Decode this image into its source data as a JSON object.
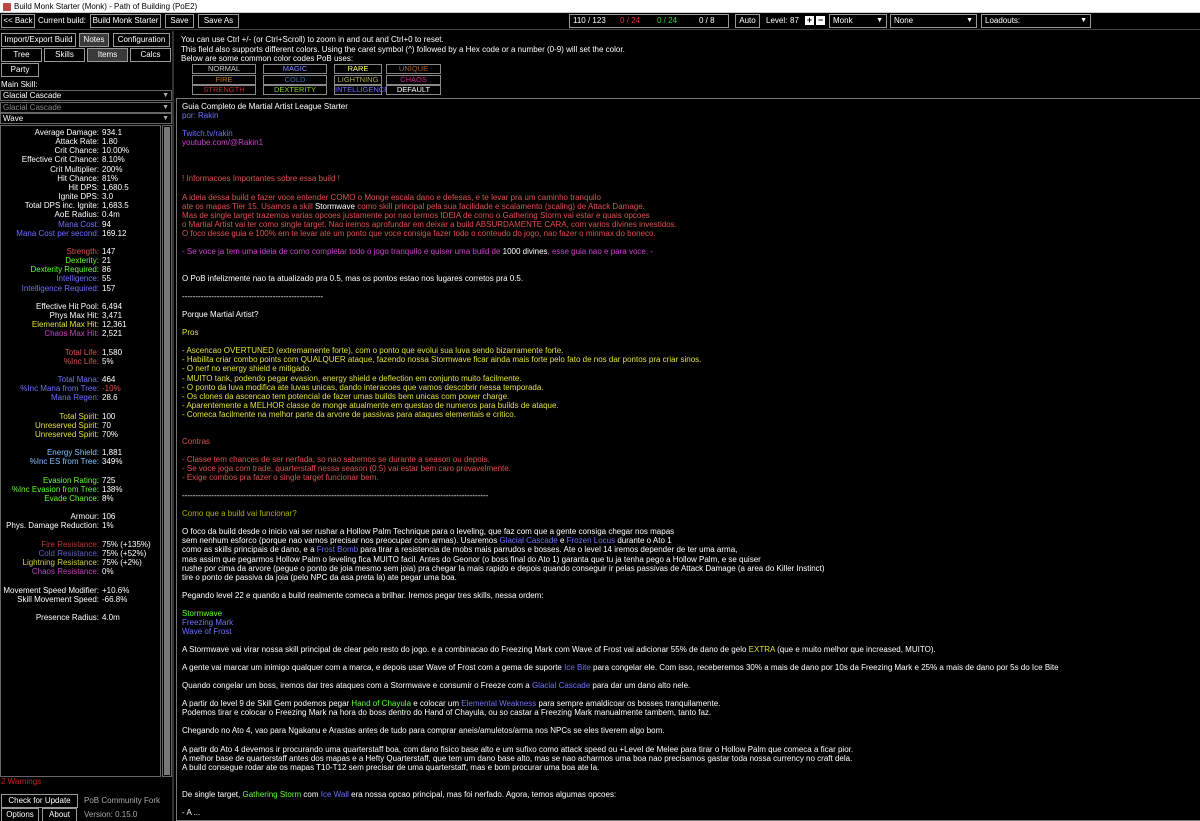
{
  "window": {
    "title": "Build Monk Starter (Monk) - Path of Building (PoE2)"
  },
  "topbar": {
    "back_label": "<< Back",
    "current_build_label": "Current build:",
    "build_name": "Build Monk Starter",
    "save_label": "Save",
    "save_as_label": "Save As",
    "points_main": "110 / 123",
    "points_red": "0 / 24",
    "points_green": "0 / 24",
    "points_white": "0 / 8",
    "auto_label": "Auto",
    "level_label": "Level:",
    "level_value": "87",
    "plus": "+",
    "minus": "−",
    "class_value": "Monk",
    "ascend_value": "None",
    "loadouts_value": "Loadouts:"
  },
  "left": {
    "tabs": [
      "Import/Export Build",
      "Notes",
      "Configuration",
      "Tree",
      "Skills",
      "Items",
      "Calcs",
      "Party"
    ],
    "main_skill_label": "Main Skill:",
    "skill_select": "Glacial Cascade",
    "skill_select_2": "Glacial Cascade",
    "skill_part": "Wave",
    "stats": [
      {
        "label": "Average Damage:",
        "value": "934.1",
        "color": "#ffffff"
      },
      {
        "label": "Attack Rate:",
        "value": "1.80",
        "color": "#ffffff"
      },
      {
        "label": "Crit Chance:",
        "value": "10.00%",
        "color": "#ffffff"
      },
      {
        "label": "Effective Crit Chance:",
        "value": "8.10%",
        "color": "#ffffff"
      },
      {
        "label": "Crit Multiplier:",
        "value": "200%",
        "color": "#ffffff"
      },
      {
        "label": "Hit Chance:",
        "value": "81%",
        "color": "#ffffff"
      },
      {
        "label": "Hit DPS:",
        "value": "1,680.5",
        "color": "#ffffff"
      },
      {
        "label": "Ignite DPS:",
        "value": "3.0",
        "color": "#ffffff"
      },
      {
        "label": "Total DPS inc. Ignite:",
        "value": "1,683.5",
        "color": "#ffffff"
      },
      {
        "label": "AoE Radius:",
        "value": "0.4m",
        "color": "#ffffff"
      },
      {
        "label": "Mana Cost:",
        "value": "94",
        "color": "#7070ff"
      },
      {
        "label": "Mana Cost per second:",
        "value": "169.12",
        "color": "#7070ff"
      },
      {
        "label": "",
        "value": "",
        "color": "#ffffff"
      },
      {
        "label": "Strength:",
        "value": "147",
        "color": "#e05050"
      },
      {
        "label": "Dexterity:",
        "value": "21",
        "color": "#60ff30"
      },
      {
        "label": "Dexterity Required:",
        "value": "86",
        "color": "#60ff30"
      },
      {
        "label": "Intelligence:",
        "value": "55",
        "color": "#7070ff"
      },
      {
        "label": "Intelligence Required:",
        "value": "157",
        "color": "#7070ff"
      },
      {
        "label": "",
        "value": "",
        "color": "#ffffff"
      },
      {
        "label": "Effective Hit Pool:",
        "value": "6,494",
        "color": "#ffffff"
      },
      {
        "label": "Phys Max Hit:",
        "value": "3,471",
        "color": "#ffffff"
      },
      {
        "label": "Elemental Max Hit:",
        "value": "12,361",
        "color": "#e0e040"
      },
      {
        "label": "Chaos Max Hit:",
        "value": "2,521",
        "color": "#d040d0"
      },
      {
        "label": "",
        "value": "",
        "color": "#ffffff"
      },
      {
        "label": "Total Life:",
        "value": "1,580",
        "color": "#e05050"
      },
      {
        "label": "%Inc Life:",
        "value": "5%",
        "color": "#e05050"
      },
      {
        "label": "",
        "value": "",
        "color": "#ffffff"
      },
      {
        "label": "Total Mana:",
        "value": "464",
        "color": "#7070ff"
      },
      {
        "label": "%Inc Mana from Tree:",
        "value": "-10%",
        "color": "#7070ff",
        "valcolor": "#e05050"
      },
      {
        "label": "Mana Regen:",
        "value": "28.6",
        "color": "#7070ff"
      },
      {
        "label": "",
        "value": "",
        "color": "#ffffff"
      },
      {
        "label": "Total Spirit:",
        "value": "100",
        "color": "#e0e040"
      },
      {
        "label": "Unreserved Spirit:",
        "value": "70",
        "color": "#e0e040"
      },
      {
        "label": "Unreserved Spirit:",
        "value": "70%",
        "color": "#e0e040"
      },
      {
        "label": "",
        "value": "",
        "color": "#ffffff"
      },
      {
        "label": "Energy Shield:",
        "value": "1,881",
        "color": "#80c0ff"
      },
      {
        "label": "%Inc ES from Tree:",
        "value": "349%",
        "color": "#80c0ff"
      },
      {
        "label": "",
        "value": "",
        "color": "#ffffff"
      },
      {
        "label": "Evasion Rating:",
        "value": "725",
        "color": "#60ff30"
      },
      {
        "label": "%Inc Evasion from Tree:",
        "value": "138%",
        "color": "#60ff30"
      },
      {
        "label": "Evade Chance:",
        "value": "8%",
        "color": "#60ff30"
      },
      {
        "label": "",
        "value": "",
        "color": "#ffffff"
      },
      {
        "label": "Armour:",
        "value": "106",
        "color": "#ffffff"
      },
      {
        "label": "Phys. Damage Reduction:",
        "value": "1%",
        "color": "#ffffff"
      },
      {
        "label": "",
        "value": "",
        "color": "#ffffff"
      },
      {
        "label": "Fire Resistance:",
        "value": "75% (+135%)",
        "color": "#c03030"
      },
      {
        "label": "Cold Resistance:",
        "value": "75% (+52%)",
        "color": "#6060d0"
      },
      {
        "label": "Lightning Resistance:",
        "value": "75% (+2%)",
        "color": "#d0d040"
      },
      {
        "label": "Chaos Resistance:",
        "value": "0%",
        "color": "#c040c0"
      },
      {
        "label": "",
        "value": "",
        "color": "#ffffff"
      },
      {
        "label": "Movement Speed Modifier:",
        "value": "+10.6%",
        "color": "#ffffff"
      },
      {
        "label": "Skill Movement Speed:",
        "value": "-66.8%",
        "color": "#ffffff"
      },
      {
        "label": "",
        "value": "",
        "color": "#ffffff"
      },
      {
        "label": "Presence Radius:",
        "value": "4.0m",
        "color": "#ffffff"
      }
    ],
    "warnings": "2 Warnings",
    "check_update": "Check for Update",
    "community_fork": "PoB Community Fork",
    "options": "Options",
    "about": "About",
    "version": "Version: 0.15.0"
  },
  "right": {
    "info1": "You can use Ctrl +/- (or Ctrl+Scroll) to zoom in and out and Ctrl+0 to reset.",
    "info2": "This field also supports different colors.  Using the caret symbol (^) followed by a Hex code or a number (0-9) will set the color.",
    "info3": "Below are some common color codes PoB uses:",
    "color_codes": [
      {
        "label": "NORMAL",
        "color": "#c8c8c8"
      },
      {
        "label": "MAGIC",
        "color": "#8888ff"
      },
      {
        "label": "RARE",
        "color": "#ffff77"
      },
      {
        "label": "UNIQUE",
        "color": "#af6025"
      },
      {
        "label": "FIRE",
        "color": "#b97123"
      },
      {
        "label": "COLD",
        "color": "#3f6db3"
      },
      {
        "label": "LIGHTNING",
        "color": "#adaa47"
      },
      {
        "label": "CHAOS",
        "color": "#d02090"
      },
      {
        "label": "STRENGTH",
        "color": "#b9302b"
      },
      {
        "label": "DEXTERITY",
        "color": "#7fd22e"
      },
      {
        "label": "INTELLIGENCE",
        "color": "#6f6fff"
      },
      {
        "label": "DEFAULT",
        "color": "#ffffff"
      }
    ],
    "notes": [
      [
        [
          "w",
          "Guia Completo de Martial Artist League Starter"
        ]
      ],
      [
        [
          "b",
          "por: Rakin"
        ]
      ],
      [],
      [
        [
          "b",
          "Twitch.tv/rakin"
        ]
      ],
      [
        [
          "p",
          "youtube.com/@Rakin1"
        ]
      ],
      [],
      [],
      [],
      [
        [
          "m",
          "! Informacoes Importantes sobre essa build !"
        ]
      ],
      [],
      [
        [
          "m",
          "A ideia dessa build e fazer voce entender COMO o Monge escala dano e defesas, e te levar pra um caminho tranquilo"
        ]
      ],
      [
        [
          "m",
          "ate os mapas Tier 15. Usamos a skill "
        ],
        [
          "w",
          "Stormwave"
        ],
        [
          "m",
          " como skill principal pela sua facilidade e scalamento (scaling) de Attack Damage."
        ]
      ],
      [
        [
          "m",
          "Mas de single target trazemos varias opcoes justamente por nao termos IDEIA de como o Gathering Storm vai estar e quais opcoes"
        ]
      ],
      [
        [
          "m",
          "o Martial Artist vai ter como single target. Nao iremos aprofundar em deixar a build ABSURDAMENTE CARA, com varios divines investidos."
        ]
      ],
      [
        [
          "m",
          "O foco desse guia e 100% em te levar ate um ponto que voce consiga fazer todo o conteudo do jogo, nao fazer o minmax do boneco."
        ]
      ],
      [],
      [
        [
          "p",
          " - Se voce ja tem uma ideia de como completar todo o jogo tranquilo e quiser uma build de "
        ],
        [
          "w",
          "1000 divines"
        ],
        [
          "p",
          ", esse guia nao e para voce. -"
        ]
      ],
      [],
      [],
      [
        [
          "w",
          "O PoB infelizmente nao ta atualizado pra 0.5, mas os pontos estao nos lugares corretos pra 0.5."
        ]
      ],
      [],
      [
        [
          "w",
          "-----------------------------------------------------"
        ]
      ],
      [],
      [
        [
          "w",
          "Porque Martial Artist?"
        ]
      ],
      [],
      [
        [
          "y",
          "Pros"
        ]
      ],
      [],
      [
        [
          "y",
          "- Ascencao OVERTUNED (extremamente forte), com o ponto que evolui sua luva sendo bizarramente forte."
        ]
      ],
      [
        [
          "y",
          "- Habilita criar combo points com QUALQUER ataque, fazendo nossa Stormwave ficar ainda mais forte pelo fato de nos dar pontos pra criar sinos."
        ]
      ],
      [
        [
          "y",
          "- O nerf no energy shield e mitigado."
        ]
      ],
      [
        [
          "y",
          "- MUITO tank, podendo pegar evasion, energy shield e deflection em conjunto muito facilmente."
        ]
      ],
      [
        [
          "y",
          "- O ponto da luva modifica ate luvas unicas, dando interacoes que vamos descobrir nessa temporada."
        ]
      ],
      [
        [
          "y",
          "- Os clones da ascencao tem potencial de fazer umas builds bem unicas com power charge."
        ]
      ],
      [
        [
          "y",
          "- Aparentemente a MELHOR classe de monge atualmente em questao de numeros para builds de ataque."
        ]
      ],
      [
        [
          "y",
          "- Comeca facilmente na melhor parte da arvore de passivas para ataques elementais e critico."
        ]
      ],
      [],
      [],
      [
        [
          "m",
          "Contras"
        ]
      ],
      [],
      [
        [
          "m",
          "- Classe tem chances de ser nerfada, so nao sabemos se durante a season ou depois."
        ]
      ],
      [
        [
          "m",
          "- Se voce joga com trade, quarterstaff nessa season (0.5) vai estar bem caro provavelmente."
        ]
      ],
      [
        [
          "m",
          "- Exige combos pra fazer o single target funcionar bem."
        ]
      ],
      [],
      [
        [
          "w",
          "-------------------------------------------------------------------------------------------------------------------"
        ]
      ],
      [],
      [
        [
          "s",
          "Como que a build vai funcionar?"
        ]
      ],
      [],
      [
        [
          "w",
          "O foco da build desde o inicio vai ser rushar a Hollow Palm Technique para o leveling, que faz com que a gente consiga chegar nos mapas"
        ]
      ],
      [
        [
          "w",
          "sem nenhum esforco (porque nao vamos precisar nos preocupar com armas). Usaremos "
        ],
        [
          "b",
          "Glacial Cascade"
        ],
        [
          "w",
          " e "
        ],
        [
          "b",
          "Frozen Locus"
        ],
        [
          "w",
          " durante o Ato 1"
        ]
      ],
      [
        [
          "w",
          "como as skills principais de dano, e a "
        ],
        [
          "b",
          "Frost Bomb"
        ],
        [
          "w",
          " para tirar a resistencia de mobs mais parrudos e bosses. Ate o level 14 iremos depender de ter uma arma,"
        ]
      ],
      [
        [
          "w",
          "mas assim que pegarmos Hollow Palm o leveling fica MUITO facil. Antes do Geonor (o boss final do Ato 1) garanta que tu ja tenha pego a Hollow Palm, e se quiser"
        ]
      ],
      [
        [
          "w",
          "rushe por cima da arvore (pegue o ponto de joia mesmo sem joia) pra chegar la mais rapido e depois quando conseguir ir pelas passivas de Attack Damage (a area do Killer Instinct)"
        ]
      ],
      [
        [
          "w",
          "tire o ponto de passiva da joia (pelo NPC da asa preta la) ate pegar uma boa."
        ]
      ],
      [],
      [
        [
          "w",
          "Pegando level 22 e quando a build realmente comeca a brilhar.  Iremos pegar tres skills, nessa ordem:"
        ]
      ],
      [],
      [
        [
          "g",
          "Stormwave"
        ]
      ],
      [
        [
          "b",
          "Freezing Mark"
        ]
      ],
      [
        [
          "b",
          "Wave of Frost"
        ]
      ],
      [],
      [
        [
          "w",
          "A Stormwave vai virar nossa skill principal de clear pelo resto do jogo. e a combinacao do Freezing Mark com Wave of Frost vai adicionar 55% de dano de gelo "
        ],
        [
          "y",
          "EXTRA"
        ],
        [
          "w",
          " (que e muito melhor que increased, MUITO)."
        ]
      ],
      [],
      [
        [
          "w",
          "A gente vai marcar um inimigo qualquer com a marca, e depois usar Wave of Frost com a gema de suporte "
        ],
        [
          "b",
          "Ice Bite"
        ],
        [
          "w",
          " para congelar ele. Com isso, receberemos 30% a mais de dano por 10s da Freezing Mark e 25% a mais de dano por 5s do Ice Bite"
        ]
      ],
      [],
      [
        [
          "w",
          "Quando congelar um boss, iremos dar tres ataques com a Stormwave e consumir o Freeze com a "
        ],
        [
          "b",
          "Glacial Cascade"
        ],
        [
          "w",
          " para dar um dano alto nele."
        ]
      ],
      [],
      [
        [
          "w",
          "A partir do level 9 de Skill Gem podemos pegar "
        ],
        [
          "g",
          "Hand of Chayula"
        ],
        [
          "w",
          " e colocar um "
        ],
        [
          "b",
          "Elemental Weakness"
        ],
        [
          "w",
          " para sempre amaldicoar os bosses tranquilamente."
        ]
      ],
      [
        [
          "w",
          " Podemos tirar e colocar o Freezing Mark na hora do boss dentro do Hand of Chayula, ou so castar a Freezing Mark manualmente tambem, tanto faz."
        ]
      ],
      [],
      [
        [
          "w",
          "Chegando no Ato 4, vao para Ngakanu e Arastas antes de tudo para comprar aneis/amuletos/arma nos NPCs se eles tiverem algo bom."
        ]
      ],
      [],
      [
        [
          "w",
          "A partir do Ato 4 devemos ir procurando uma quarterstaff boa, com dano fisico base alto e um sufixo como attack speed ou +Level de Melee para tirar o Hollow Palm que comeca a ficar pior."
        ]
      ],
      [
        [
          "w",
          "A melhor base de quarterstaff antes dos mapas e a Hefty Quarterstaff, que tem um dano base alto, mas se nao acharmos uma boa nao precisamos gastar toda nossa currency no craft dela."
        ]
      ],
      [
        [
          "w",
          "A build consegue rodar ate os mapas T10-T12 sem precisar de uma quarterstaff, mas e bom procurar uma boa ate la."
        ]
      ],
      [],
      [],
      [
        [
          "w",
          "De single target, "
        ],
        [
          "g",
          "Gathering Storm"
        ],
        [
          "w",
          " com "
        ],
        [
          "b",
          "Ice Wall"
        ],
        [
          "w",
          " era nossa opcao principal, mas foi nerfado. Agora, temos algumas opcoes:"
        ]
      ],
      [],
      [
        [
          "w",
          "- A "
        ],
        [
          "w",
          "..."
        ]
      ]
    ]
  }
}
